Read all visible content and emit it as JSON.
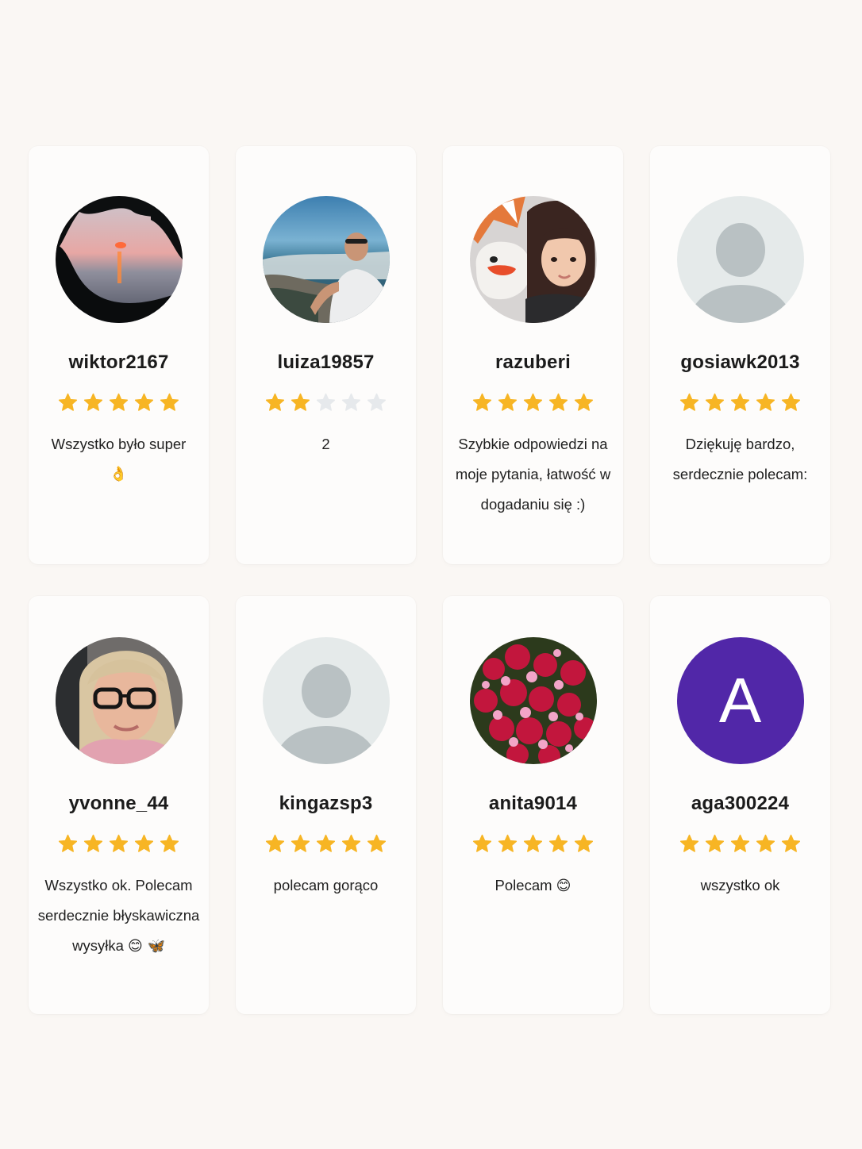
{
  "colors": {
    "background": "#faf7f4",
    "card": "#fdfcfb",
    "star_filled": "#f7b524",
    "star_empty": "#e6e9ec",
    "avatar_letter_bg": "#5127a8",
    "placeholder_bg": "#e5eaea",
    "placeholder_figure": "#b9c1c3"
  },
  "reviews": [
    {
      "username": "wiktor2167",
      "rating": 5,
      "comment": "Wszystko było super",
      "comment_emoji": "👌",
      "avatar": "sunset-photo"
    },
    {
      "username": "luiza19857",
      "rating": 2,
      "comment": "2",
      "comment_emoji": "",
      "avatar": "beach-man-photo"
    },
    {
      "username": "razuberi",
      "rating": 5,
      "comment": "Szybkie odpowiedzi na moje pytania, łatwość w dogadaniu się :)",
      "comment_emoji": "",
      "avatar": "girl-with-plush-photo"
    },
    {
      "username": "gosiawk2013",
      "rating": 5,
      "comment": "Dziękuję bardzo, serdecznie polecam:",
      "comment_emoji": "",
      "avatar": "default-user-icon"
    },
    {
      "username": "yvonne_44",
      "rating": 5,
      "comment": "Wszystko ok. Polecam serdecznie błyskawiczna wysyłka",
      "comment_emoji": "😊 🦋",
      "avatar": "woman-glasses-photo"
    },
    {
      "username": "kingazsp3",
      "rating": 5,
      "comment": "polecam gorąco",
      "comment_emoji": "",
      "avatar": "default-user-icon"
    },
    {
      "username": "anita9014",
      "rating": 5,
      "comment": "Polecam",
      "comment_emoji": "😊",
      "avatar": "flowers-photo"
    },
    {
      "username": "aga300224",
      "rating": 5,
      "comment": "wszystko ok",
      "comment_emoji": "",
      "avatar": "letter-avatar",
      "avatar_letter": "A"
    }
  ]
}
